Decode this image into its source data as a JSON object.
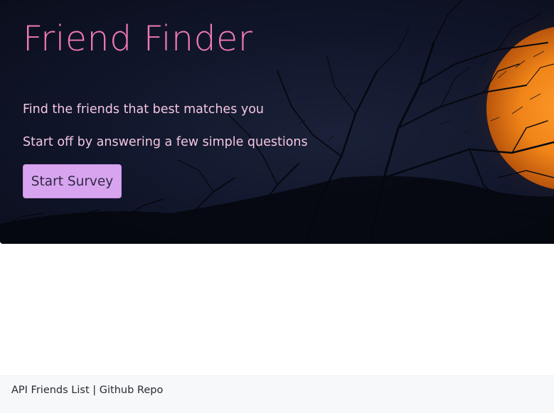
{
  "hero": {
    "title": "Friend Finder",
    "line1": "Find the friends that best matches you",
    "line2": "Start off by answering a few simple questions",
    "button_label": "Start Survey",
    "colors": {
      "title": "#f07ab8",
      "text": "#f3c6e0",
      "button_bg": "#d9a4ef",
      "moon": "#f08a1c",
      "sky": "#10152a"
    }
  },
  "footer": {
    "link_api": "API Friends List",
    "separator": "|",
    "link_github": "Github Repo"
  }
}
